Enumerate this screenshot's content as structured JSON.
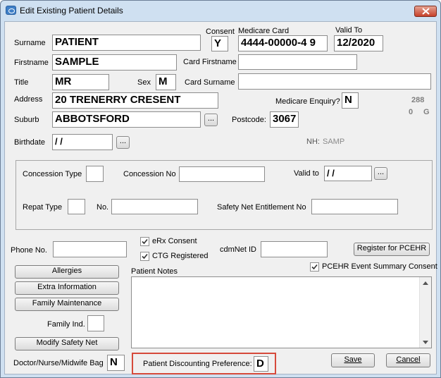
{
  "window": {
    "title": "Edit Existing Patient Details"
  },
  "fields": {
    "surname": {
      "label": "Surname",
      "value": "PATIENT"
    },
    "consent": {
      "label": "Consent",
      "value": "Y"
    },
    "medicare_card": {
      "label": "Medicare Card",
      "value": "4444-00000-4  9"
    },
    "valid_to": {
      "label": "Valid To",
      "value": "12/2020"
    },
    "firstname": {
      "label": "Firstname",
      "value": "SAMPLE"
    },
    "card_firstname": {
      "label": "Card Firstname",
      "value": ""
    },
    "title": {
      "label": "Title",
      "value": "MR"
    },
    "sex": {
      "label": "Sex",
      "value": "M"
    },
    "card_surname": {
      "label": "Card Surname",
      "value": ""
    },
    "address": {
      "label": "Address",
      "value": "20 TRENERRY CRESENT"
    },
    "medicare_enquiry": {
      "label": "Medicare Enquiry?",
      "value": "N"
    },
    "side_code_1": "288",
    "side_code_2a": "0",
    "side_code_2b": "G",
    "suburb": {
      "label": "Suburb",
      "value": "ABBOTSFORD"
    },
    "postcode": {
      "label": "Postcode:",
      "value": "3067"
    },
    "birthdate": {
      "label": "Birthdate",
      "value": " / /"
    },
    "nh_label": "NH:",
    "nh_value": "SAMP"
  },
  "concession": {
    "type_label": "Concession Type",
    "type_value": "",
    "no_label": "Concession No",
    "no_value": "",
    "valid_to_label": "Valid to",
    "valid_to_value": " / /",
    "repat_type_label": "Repat Type",
    "repat_type_value": "",
    "repat_no_label": "No.",
    "repat_no_value": "",
    "safety_net_label": "Safety Net Entitlement No",
    "safety_net_value": ""
  },
  "contact": {
    "phone_label": "Phone No.",
    "phone_value": "",
    "erx_label": "eRx Consent",
    "erx_checked": true,
    "ctg_label": "CTG Registered",
    "ctg_checked": true,
    "cdmnet_label": "cdmNet ID",
    "cdmnet_value": "",
    "register_pcehr_label": "Register for PCEHR",
    "pcehr_summary_label": "PCEHR Event Summary Consent",
    "pcehr_summary_checked": true
  },
  "buttons": {
    "allergies": "Allergies",
    "extra_information": "Extra Information",
    "family_maintenance": "Family Maintenance",
    "modify_safety_net": "Modify Safety Net",
    "save": "Save",
    "cancel": "Cancel",
    "ellipsis": "..."
  },
  "family_ind": {
    "label": "Family Ind.",
    "value": ""
  },
  "notes": {
    "label": "Patient Notes",
    "value": ""
  },
  "doctor_bag": {
    "label": "Doctor/Nurse/Midwife Bag",
    "value": "N"
  },
  "discount": {
    "label": "Patient Discounting Preference:",
    "value": "D"
  },
  "colors": {
    "highlight_border": "#d64a3b",
    "window_frame": "#cfe0f1",
    "client_bg": "#f0f0f0"
  }
}
